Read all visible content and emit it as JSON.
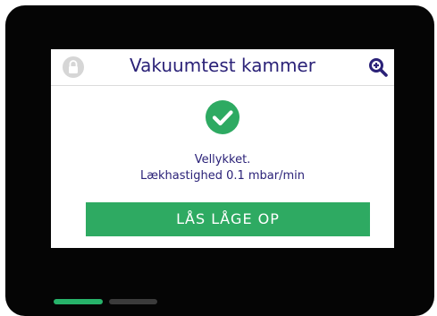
{
  "header": {
    "title": "Vakuumtest kammer",
    "lock_icon": "lock-icon",
    "zoom_icon": "zoom-in-icon"
  },
  "status": {
    "icon": "checkmark-circle-icon",
    "line1": "Vellykket.",
    "line2": "Lækhastighed 0.1 mbar/min"
  },
  "action": {
    "unlock_label": "LÅS LÅGE OP"
  },
  "pagination": {
    "total_pages": 2,
    "active_page": 1
  },
  "colors": {
    "title_text": "#2b2278",
    "accent_green": "#2eaa62",
    "indicator_active": "#27b36a",
    "indicator_inactive": "#3b3b3b",
    "bezel": "#050505",
    "lock_gray": "#d6d6d6"
  }
}
